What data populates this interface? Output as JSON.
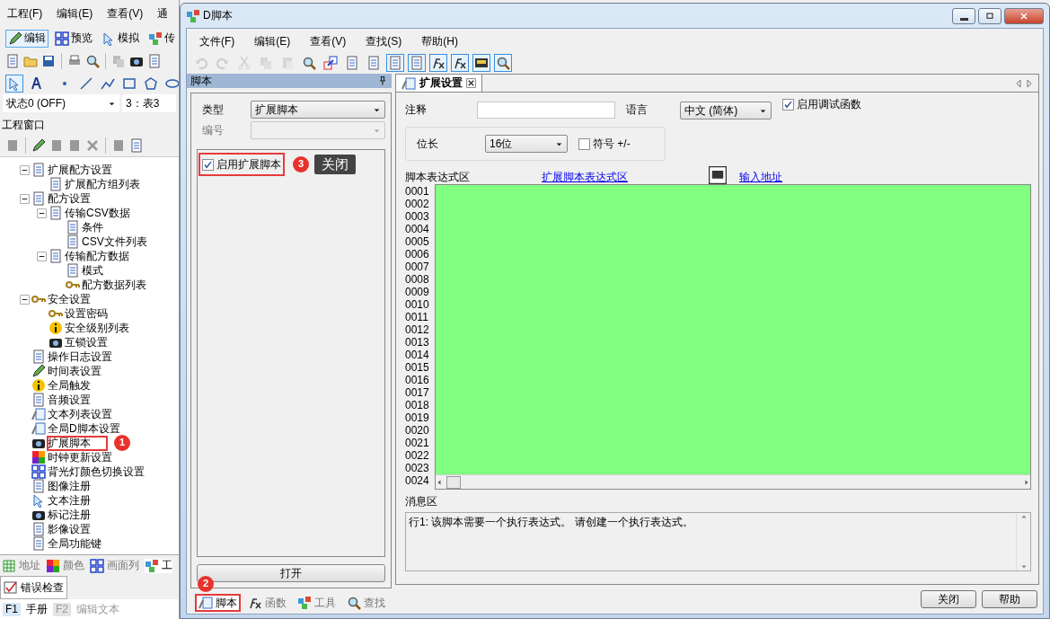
{
  "app": {
    "menu": [
      "工程(F)",
      "编辑(E)",
      "查看(V)",
      "通"
    ],
    "modes": [
      {
        "label": "编辑",
        "selected": true
      },
      {
        "label": "预览",
        "selected": false
      },
      {
        "label": "模拟",
        "selected": false
      },
      {
        "label": "传",
        "selected": false
      }
    ],
    "draw_tools": [
      {
        "selected": true
      },
      {
        "selected": false
      },
      {
        "selected": false
      },
      {
        "selected": false
      },
      {
        "selected": false
      },
      {
        "selected": false
      },
      {
        "selected": false
      },
      {
        "selected": false
      }
    ],
    "state_select": "状态0 (OFF)",
    "screen_label": "3：表3",
    "project_window": {
      "title": "工程窗口",
      "tree": [
        {
          "label": "扩展配方设置",
          "expanded": true,
          "children": [
            {
              "label": "扩展配方组列表"
            }
          ]
        },
        {
          "label": "配方设置",
          "expanded": true,
          "children": [
            {
              "label": "传输CSV数据",
              "expanded": true,
              "children": [
                {
                  "label": "条件"
                },
                {
                  "label": "CSV文件列表"
                }
              ]
            },
            {
              "label": "传输配方数据",
              "expanded": true,
              "children": [
                {
                  "label": "模式"
                },
                {
                  "label": "配方数据列表"
                }
              ]
            }
          ]
        },
        {
          "label": "安全设置",
          "expanded": true,
          "children": [
            {
              "label": "设置密码"
            },
            {
              "label": "安全级别列表"
            },
            {
              "label": "互锁设置"
            }
          ]
        },
        {
          "label": "操作日志设置"
        },
        {
          "label": "时间表设置"
        },
        {
          "label": "全局触发"
        },
        {
          "label": "音频设置"
        },
        {
          "label": "文本列表设置"
        },
        {
          "label": "全局D脚本设置"
        },
        {
          "label": "扩展脚本",
          "highlighted": true,
          "annotation": "1"
        },
        {
          "label": "时钟更新设置"
        },
        {
          "label": "背光灯颜色切换设置"
        },
        {
          "label": "图像注册"
        },
        {
          "label": "文本注册"
        },
        {
          "label": "标记注册"
        },
        {
          "label": "影像设置"
        },
        {
          "label": "全局功能键"
        }
      ]
    },
    "bottom_tabs": [
      {
        "label": "地址",
        "selected": false
      },
      {
        "label": "颜色",
        "selected": false
      },
      {
        "label": "画面列",
        "selected": false
      },
      {
        "label": "工",
        "selected": true
      }
    ],
    "error_tab": "错误检查",
    "status_bar": [
      {
        "key": "F1",
        "label": "手册",
        "disabled": false
      },
      {
        "key": "F2",
        "label": "编辑文本",
        "disabled": true
      }
    ]
  },
  "dialog": {
    "title": "D脚本",
    "menu": [
      "文件(F)",
      "编辑(E)",
      "查看(V)",
      "查找(S)",
      "帮助(H)"
    ],
    "toolbar": [
      {
        "disabled": true,
        "selected": false
      },
      {
        "disabled": true,
        "selected": false
      },
      {
        "disabled": true,
        "selected": false
      },
      {
        "disabled": true,
        "selected": false
      },
      {
        "disabled": true,
        "selected": false
      },
      {
        "disabled": false,
        "selected": false
      },
      {
        "disabled": false,
        "selected": false
      },
      {
        "disabled": false,
        "selected": false
      },
      {
        "disabled": false,
        "selected": false
      },
      {
        "disabled": false,
        "selected": true
      },
      {
        "disabled": false,
        "selected": true
      },
      {
        "disabled": false,
        "selected": true
      },
      {
        "disabled": false,
        "selected": true
      },
      {
        "disabled": false,
        "selected": true
      },
      {
        "disabled": false,
        "selected": true
      }
    ],
    "script_panel": {
      "title": "脚本",
      "type_label": "类型",
      "type_value": "扩展脚本",
      "number_label": "编号",
      "enable": {
        "label": "启用扩展脚本",
        "checked": true,
        "highlighted": true,
        "annotation": "3",
        "tooltip": "关闭"
      },
      "open_button": "打开",
      "tabs": [
        {
          "label": "脚本",
          "selected": true,
          "highlighted": true,
          "annotation": "2"
        },
        {
          "label": "函数",
          "selected": false
        },
        {
          "label": "工具",
          "selected": false
        },
        {
          "label": "查找",
          "selected": false
        }
      ]
    },
    "editor_tab": {
      "label": "扩展设置",
      "selected": true
    },
    "comment_label": "注释",
    "language_label": "语言",
    "language_value": "中文 (简体)",
    "debug": {
      "label": "启用调试函数",
      "checked": true
    },
    "bit_label": "位长",
    "bit_value": "16位",
    "signed": {
      "label": "符号",
      "suffix": "+/-",
      "checked": false
    },
    "expr_label": "脚本表达式区",
    "expr_link": "扩展脚本表达式区",
    "address_link": "输入地址",
    "line_numbers": [
      "0001",
      "0002",
      "0003",
      "0004",
      "0005",
      "0006",
      "0007",
      "0008",
      "0009",
      "0010",
      "0011",
      "0012",
      "0013",
      "0014",
      "0015",
      "0016",
      "0017",
      "0018",
      "0019",
      "0020",
      "0021",
      "0022",
      "0023",
      "0024"
    ],
    "message_label": "消息区",
    "message": "行1: 该脚本需要一个执行表达式。 请创建一个执行表达式。",
    "buttons": [
      "关闭",
      "帮助"
    ]
  }
}
